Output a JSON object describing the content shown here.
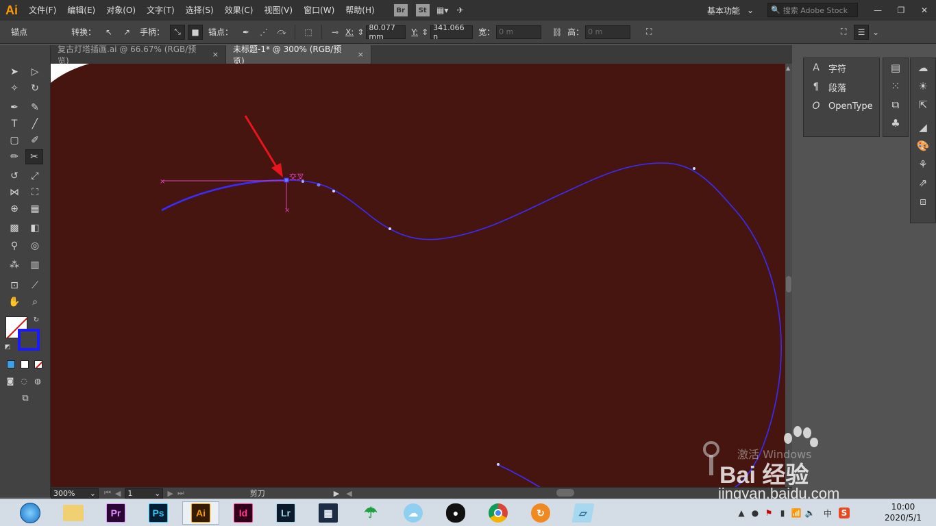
{
  "app": {
    "logo": "Ai"
  },
  "menu": {
    "items": [
      "文件(F)",
      "编辑(E)",
      "对象(O)",
      "文字(T)",
      "选择(S)",
      "效果(C)",
      "视图(V)",
      "窗口(W)",
      "帮助(H)"
    ],
    "bridge_badge": "Br",
    "stock_badge": "St",
    "workspace": "基本功能",
    "stock_search_placeholder": "搜索 Adobe Stock"
  },
  "control": {
    "anchor_label": "锚点",
    "convert_label": "转换：",
    "handles_label": "手柄：",
    "anchors_label": "锚点：",
    "x_label": "X:",
    "x_value": "80.077 mm",
    "y_label": "Y:",
    "y_value": "341.066 n",
    "w_label": "宽：",
    "w_value": "0 m",
    "h_label": "高：",
    "h_value": "0 m"
  },
  "tabs": [
    {
      "label": "复古灯塔插画.ai @ 66.67% (RGB/预览)",
      "close": "×",
      "active": false
    },
    {
      "label": "未标题-1* @ 300% (RGB/预览)",
      "close": "×",
      "active": true
    }
  ],
  "canvas": {
    "intersect_hint": "交叉",
    "colors": {
      "artboard": "#47150f",
      "path": "#3a2cff",
      "guide": "#e040c0",
      "arrow": "#e8141e"
    }
  },
  "status": {
    "zoom": "300%",
    "artboard_num": "1",
    "tool_name": "剪刀"
  },
  "panels": {
    "character": "字符",
    "paragraph": "段落",
    "opentype": "OpenType"
  },
  "watermark": {
    "activate": "激活 Windows",
    "baidu": "Bai  经验",
    "url": "jingyan.baidu.com"
  },
  "taskbar": {
    "apps": [
      "Pr",
      "Ps",
      "Ai",
      "Id",
      "Lr"
    ],
    "ime": "中",
    "time": "10:00",
    "date": "2020/5/1"
  }
}
